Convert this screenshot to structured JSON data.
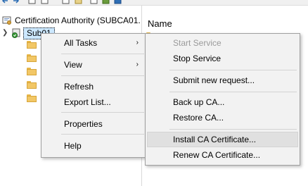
{
  "tree": {
    "root_label": "Certification Authority (SUBCA01.",
    "selected_node": "Sub01",
    "folder_count": 5
  },
  "list": {
    "column_name": "Name"
  },
  "context_menu": {
    "items": [
      {
        "label": "All Tasks",
        "has_submenu": true
      },
      {
        "label": "View",
        "has_submenu": true
      },
      {
        "label": "Refresh"
      },
      {
        "label": "Export List..."
      },
      {
        "label": "Properties"
      },
      {
        "label": "Help"
      }
    ],
    "submenu_arrow": "›"
  },
  "tasks_menu": {
    "items": [
      {
        "label": "Start Service",
        "enabled": false
      },
      {
        "label": "Stop Service",
        "enabled": true
      },
      {
        "label": "Submit new request...",
        "enabled": true
      },
      {
        "label": "Back up CA...",
        "enabled": true
      },
      {
        "label": "Restore CA...",
        "enabled": true
      },
      {
        "label": "Install CA Certificate...",
        "enabled": true,
        "highlighted": true
      },
      {
        "label": "Renew CA Certificate...",
        "enabled": true
      }
    ]
  },
  "colors": {
    "menu_bg": "#f2f2f2",
    "highlight_bg": "#e0e0e0",
    "selection_bg": "#cce8ff",
    "disabled_text": "#9a9a9a",
    "folder": "#f2c766"
  },
  "icons": {
    "root": "certificate-authority-icon",
    "node": "ca-server-icon",
    "folder": "folder-icon",
    "expander": "chevron-down-icon",
    "submenu": "chevron-right-icon"
  }
}
